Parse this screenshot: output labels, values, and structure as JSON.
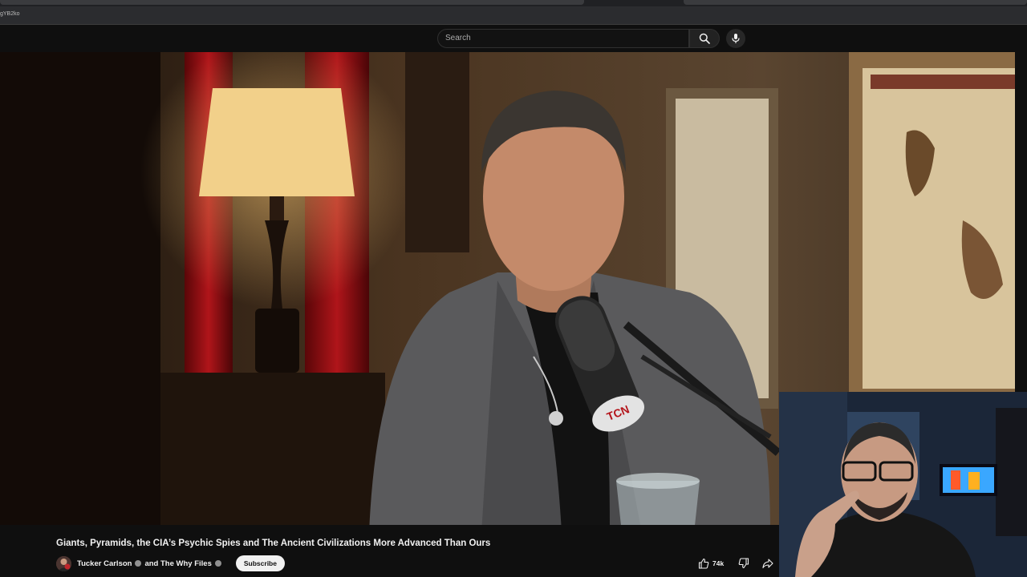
{
  "browser": {
    "url_fragment": "gYB2ko"
  },
  "header": {
    "search_placeholder": "Search",
    "icons": [
      "search-icon",
      "microphone-icon"
    ]
  },
  "video": {
    "mic_logo_text": "TCN"
  },
  "title": "Giants, Pyramids, the CIA’s Psychic Spies and The Ancient Civilizations More Advanced Than Ours",
  "channel": {
    "name": "Tucker Carlson",
    "joiner": "and The Why Files",
    "subscribe_label": "Subscribe"
  },
  "actions": {
    "like_count": "74k",
    "icons": [
      "thumbs-up-icon",
      "thumbs-down-icon",
      "share-icon"
    ]
  },
  "colors": {
    "background": "#0f0f0f",
    "text": "#f1f1f1",
    "subscribe_bg": "#f1f1f1"
  }
}
